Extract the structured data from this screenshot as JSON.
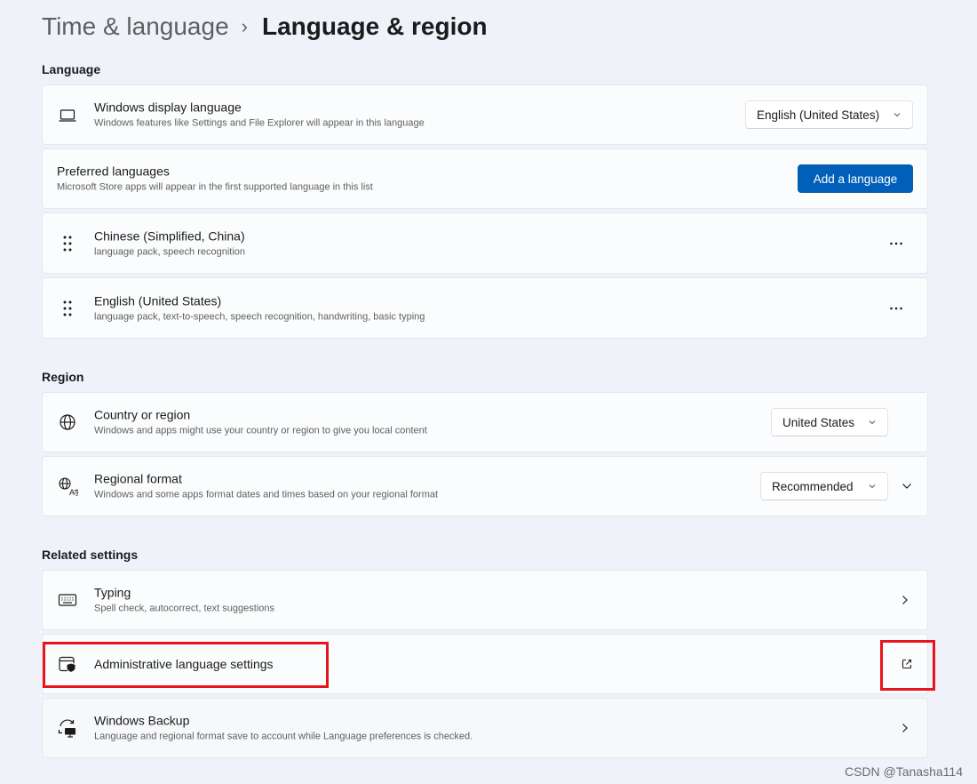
{
  "breadcrumb": {
    "parent": "Time & language",
    "current": "Language & region"
  },
  "sections": {
    "language": "Language",
    "region": "Region",
    "related": "Related settings"
  },
  "display_language": {
    "title": "Windows display language",
    "subtitle": "Windows features like Settings and File Explorer will appear in this language",
    "value": "English (United States)",
    "icon": "laptop-icon"
  },
  "preferred_languages": {
    "title": "Preferred languages",
    "subtitle": "Microsoft Store apps will appear in the first supported language in this list",
    "button": "Add a language"
  },
  "languages": [
    {
      "name": "Chinese (Simplified, China)",
      "features": "language pack, speech recognition"
    },
    {
      "name": "English (United States)",
      "features": "language pack, text-to-speech, speech recognition, handwriting, basic typing"
    }
  ],
  "country": {
    "title": "Country or region",
    "subtitle": "Windows and apps might use your country or region to give you local content",
    "value": "United States",
    "icon": "globe-icon"
  },
  "regional_format": {
    "title": "Regional format",
    "subtitle": "Windows and some apps format dates and times based on your regional format",
    "value": "Recommended",
    "icon": "regional-format-icon"
  },
  "typing": {
    "title": "Typing",
    "subtitle": "Spell check, autocorrect, text suggestions",
    "icon": "keyboard-icon"
  },
  "admin_language": {
    "title": "Administrative language settings",
    "icon": "admin-shield-icon"
  },
  "backup": {
    "title": "Windows Backup",
    "subtitle": "Language and regional format save to account while Language preferences is checked.",
    "icon": "backup-sync-icon"
  },
  "highlight_color": "#e8141b",
  "accent_color": "#005fb8",
  "watermark": "CSDN @Tanasha114"
}
